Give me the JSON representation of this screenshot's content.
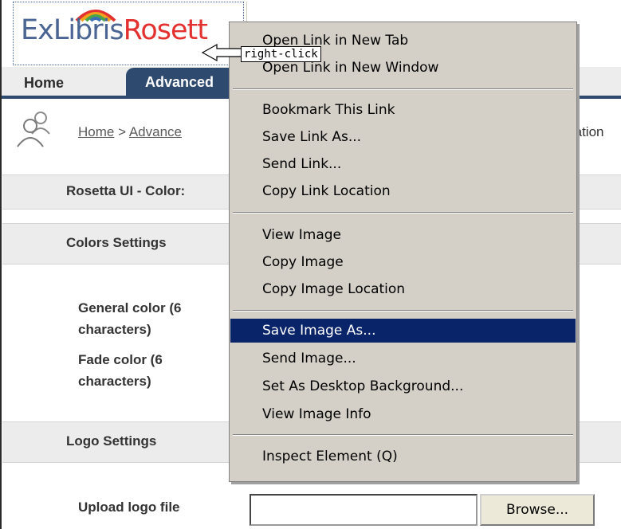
{
  "logo": {
    "ex_text": "ExLibris",
    "brand_text": "Rosett"
  },
  "tabs": [
    {
      "label": "Home"
    },
    {
      "label": "Advanced"
    }
  ],
  "breadcrumb": {
    "home": "Home",
    "separator": ">",
    "current": "Advance",
    "tail": "tomization"
  },
  "sections": {
    "ui_title": "Rosetta UI - Color:",
    "colors_title": "Colors Settings",
    "logo_title": "Logo Settings"
  },
  "fields": {
    "general_color_line1": "General color (6",
    "general_color_line2": "characters)",
    "fade_color_line1": "Fade color (6",
    "fade_color_line2": "characters)",
    "upload_logo": "Upload logo file",
    "file_value": "",
    "browse": "Browse..."
  },
  "context_menu": {
    "groups": [
      [
        "Open Link in New Tab",
        "Open Link in New Window"
      ],
      [
        "Bookmark This Link",
        "Save Link As...",
        "Send Link...",
        "Copy Link Location"
      ],
      [
        "View Image",
        "Copy Image",
        "Copy Image Location"
      ],
      [
        "Save Image As...",
        "Send Image...",
        "Set As Desktop Background...",
        "View Image Info"
      ],
      [
        "Inspect Element (Q)"
      ]
    ],
    "selected": "Save Image As..."
  },
  "callout": {
    "label": "right-click"
  },
  "colors": {
    "nav": "#2f4a6f",
    "menu_bg": "#d4d0c8",
    "menu_selected": "#0a246a",
    "brand_red": "#e2312f",
    "brand_blue": "#4a6494"
  }
}
